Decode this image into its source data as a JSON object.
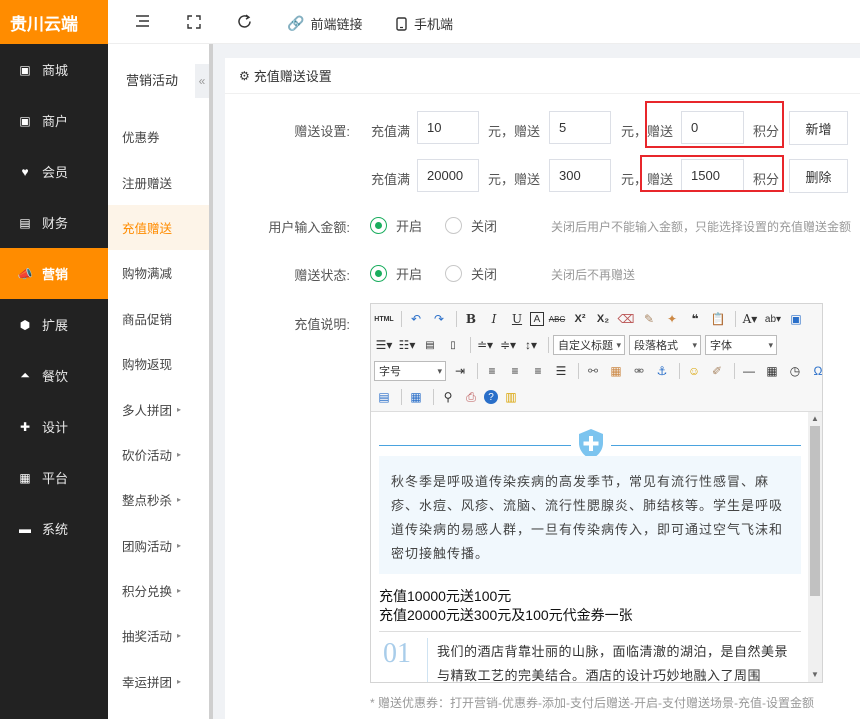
{
  "brand": "贵川云端",
  "nav": [
    {
      "label": "商城",
      "icon": "shop-icon"
    },
    {
      "label": "商户",
      "icon": "merchant-icon"
    },
    {
      "label": "会员",
      "icon": "member-icon"
    },
    {
      "label": "财务",
      "icon": "finance-icon"
    },
    {
      "label": "营销",
      "icon": "marketing-icon"
    },
    {
      "label": "扩展",
      "icon": "extend-icon"
    },
    {
      "label": "餐饮",
      "icon": "dining-icon"
    },
    {
      "label": "设计",
      "icon": "design-icon"
    },
    {
      "label": "平台",
      "icon": "platform-icon"
    },
    {
      "label": "系统",
      "icon": "system-icon"
    }
  ],
  "subnav": {
    "title": "营销活动",
    "collapse": "«",
    "items": [
      {
        "label": "优惠券",
        "arrow": ""
      },
      {
        "label": "注册赠送",
        "arrow": ""
      },
      {
        "label": "充值赠送",
        "arrow": ""
      },
      {
        "label": "购物满减",
        "arrow": ""
      },
      {
        "label": "商品促销",
        "arrow": ""
      },
      {
        "label": "购物返现",
        "arrow": ""
      },
      {
        "label": "多人拼团",
        "arrow": "▸"
      },
      {
        "label": "砍价活动",
        "arrow": "▸"
      },
      {
        "label": "整点秒杀",
        "arrow": "▸"
      },
      {
        "label": "团购活动",
        "arrow": "▸"
      },
      {
        "label": "积分兑换",
        "arrow": "▸"
      },
      {
        "label": "抽奖活动",
        "arrow": "▸"
      },
      {
        "label": "幸运拼团",
        "arrow": "▸"
      }
    ]
  },
  "topbar": {
    "frontend_link": "前端链接",
    "mobile": "手机端"
  },
  "panel": {
    "title": "充值赠送设置",
    "gift_label": "赠送设置:",
    "rows": [
      {
        "prefix": "充值满",
        "amount": "10",
        "mid": "元，赠送",
        "gift": "5",
        "unit": "元，",
        "give": "赠送",
        "points": "0",
        "points_unit": "积分",
        "button": "新增"
      },
      {
        "prefix": "充值满",
        "amount": "20000",
        "mid": "元，赠送",
        "gift": "300",
        "unit": "元，",
        "give": "赠送",
        "points": "1500",
        "points_unit": "积分",
        "button": "删除"
      }
    ],
    "user_input_label": "用户输入金额:",
    "user_input_on": "开启",
    "user_input_off": "关闭",
    "user_input_hint": "关闭后用户不能输入金额，只能选择设置的充值赠送金额",
    "status_label": "赠送状态:",
    "status_on": "开启",
    "status_off": "关闭",
    "status_hint": "关闭后不再赠送",
    "desc_label": "充值说明:",
    "footnote": "* 赠送优惠券：打开营销-优惠券-添加-支付后赠送-开启-支付赠送场景-充值-设置金额"
  },
  "editor": {
    "select_custom_title": "自定义标题",
    "select_paragraph": "段落格式",
    "select_font": "字体",
    "select_size": "字号",
    "paragraph1": "秋冬季是呼吸道传染疾病的高发季节，常见有流行性感冒、麻疹、水痘、风疹、流脑、流行性腮腺炎、肺结核等。学生是呼吸道传染病的易感人群，一旦有传染病传入，即可通过空气飞沫和密切接触传播。",
    "line1": "充值10000元送100元",
    "line2": "充值20000元送300元及100元代金券一张",
    "number": "01",
    "paragraph2": "我们的酒店背靠壮丽的山脉，面临清澈的湖泊，是自然美景与精致工艺的完美结合。酒店的设计巧妙地融入了周围"
  },
  "colors": {
    "accent": "#ff8c00",
    "sidebar": "#222222",
    "radio": "#1aad5e",
    "highlight": "#e8262b",
    "editor_accent": "#4aa3df"
  }
}
